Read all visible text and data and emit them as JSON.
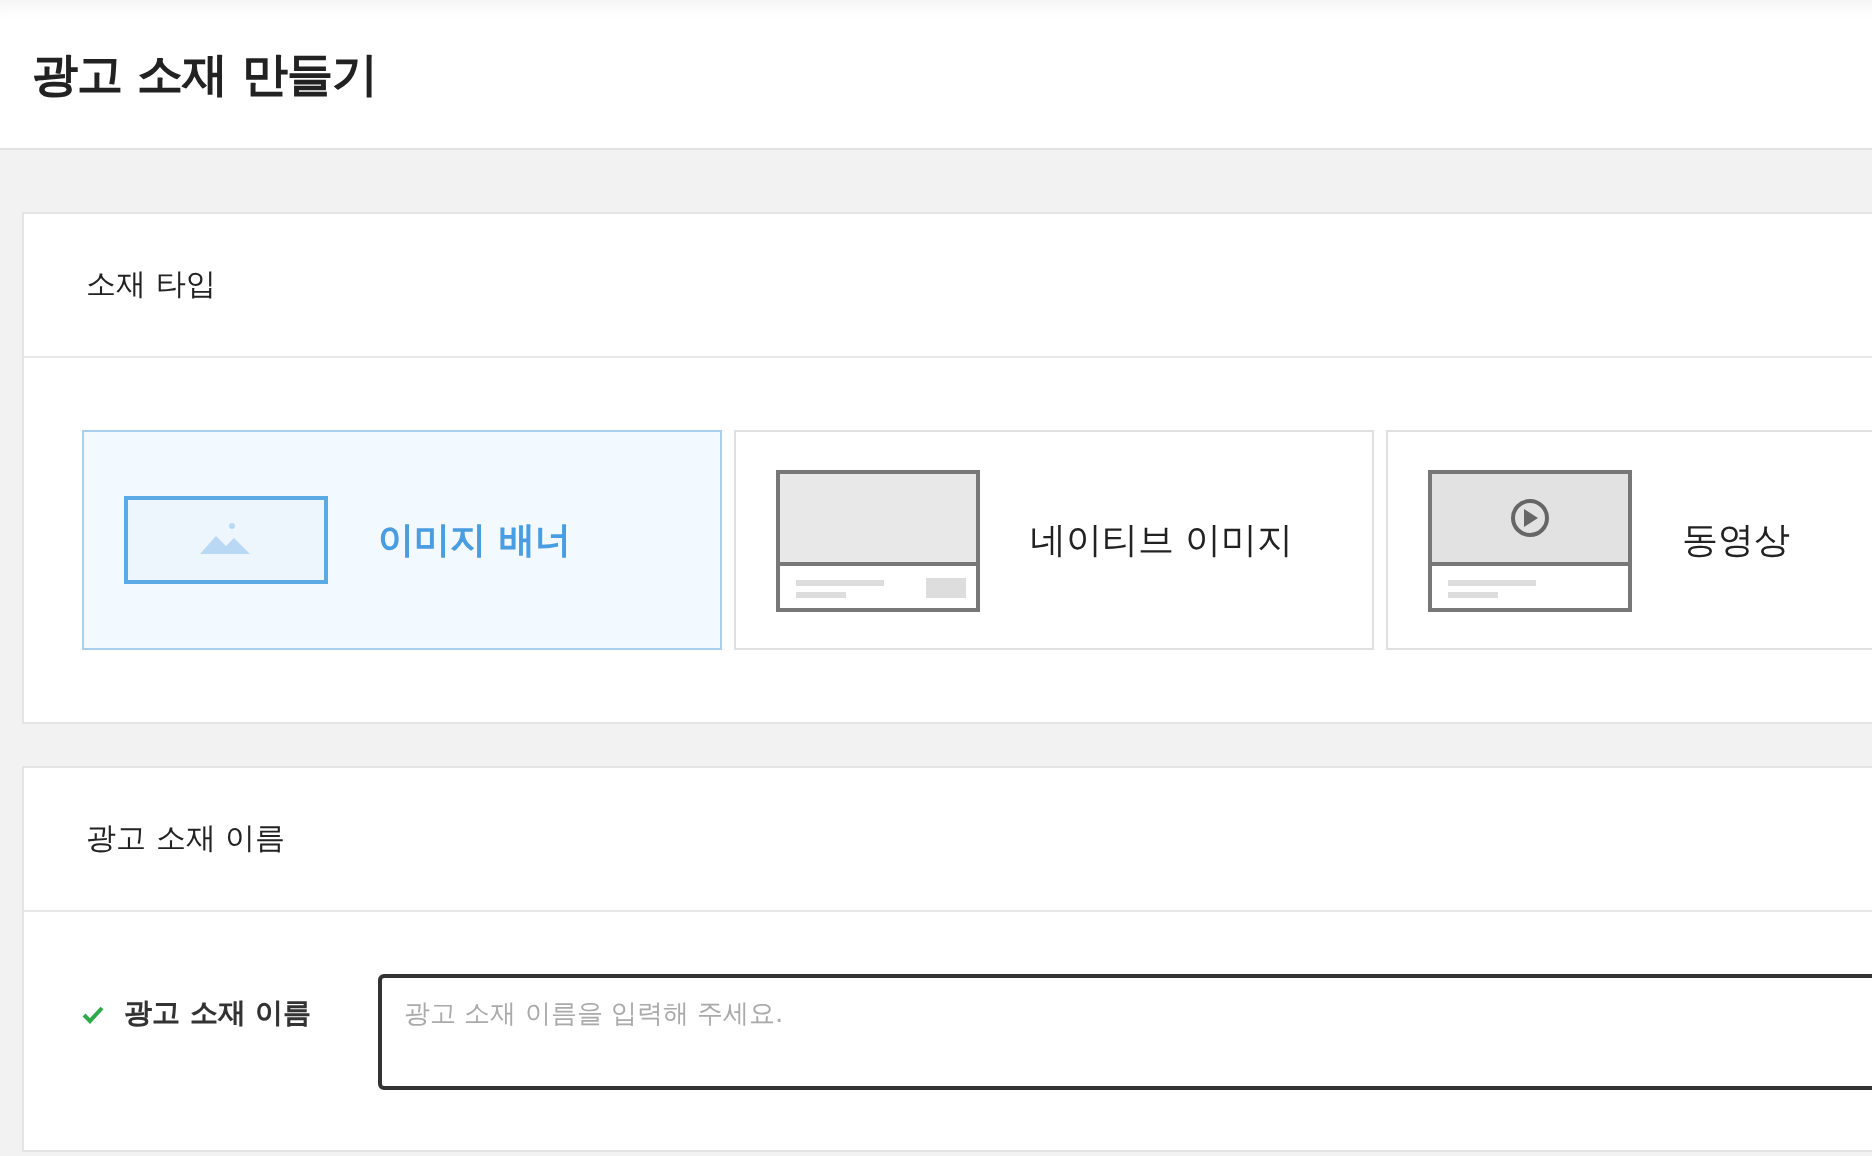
{
  "page": {
    "title": "광고 소재 만들기"
  },
  "type_panel": {
    "title": "소재 타입",
    "options": [
      {
        "kind": "banner",
        "label": "이미지 배너",
        "selected": true
      },
      {
        "kind": "native",
        "label": "네이티브 이미지",
        "selected": false
      },
      {
        "kind": "video",
        "label": "동영상",
        "selected": false
      }
    ]
  },
  "name_panel": {
    "title": "광고 소재 이름",
    "field": {
      "label": "광고 소재 이름",
      "placeholder": "광고 소재 이름을 입력해 주세요."
    }
  }
}
